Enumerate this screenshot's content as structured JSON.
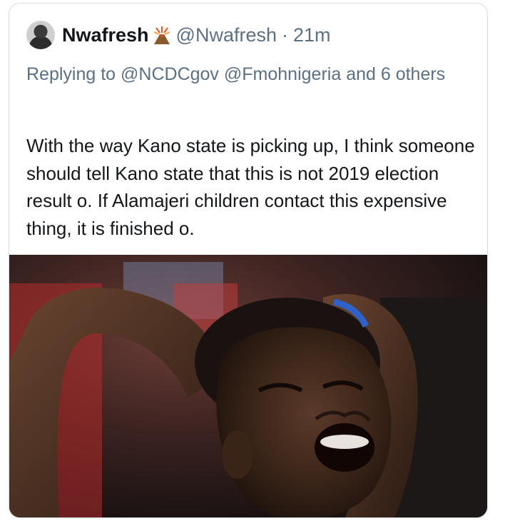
{
  "tweet": {
    "display_name": "Nwafresh",
    "handle": "@Nwafresh",
    "separator": "·",
    "time": "21m",
    "replying_to_prefix": "Replying to",
    "reply_mention_1": "@NCDCgov",
    "reply_mention_2": "@Fmohnigeria",
    "reply_suffix": "and 6 others",
    "text": "With the way Kano state is picking up, I think someone should tell Kano state that this is not 2019 election result o. If Alamajeri children contact this expensive thing, it is finished o.",
    "name_emoji_icon": "volcano-icon",
    "photo_description_icon": "crying-woman-photo"
  },
  "colors": {
    "text_primary": "#14171a",
    "text_secondary": "#5b7083",
    "border": "#d9dde1"
  }
}
